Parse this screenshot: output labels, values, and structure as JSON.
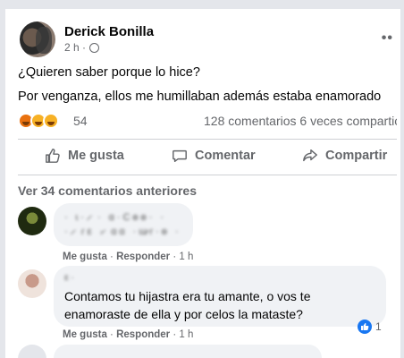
{
  "post": {
    "author": "Derick Bonilla",
    "time": "2 h ·",
    "line1": "¿Quieren saber porque lo hice?",
    "line2": "Por venganza, ellos me humillaban además estaba enamorado",
    "reaction_count": "54",
    "stats": "128 comentarios  6 veces compartic"
  },
  "actions": {
    "like": "Me gusta",
    "comment": "Comentar",
    "share": "Compartir"
  },
  "comments": {
    "view_more": "Ver 34 comentarios anteriores",
    "c1": {
      "line1": "· ɩ· ̷  ·  ɑ·Cɵɵ·  ·",
      "line2": "· ̷ ɾɛ ·̷   ɑɑ ·ɯ̷ɾ·ɵ  ·",
      "meta_like": "Me gusta",
      "meta_reply": "Responder",
      "meta_time": "1 h"
    },
    "c2": {
      "name": "ɛ ·",
      "text": "Contamos tu hijastra era tu amante, o vos te enamoraste de ella y por celos la mataste?",
      "reaction_count": "1",
      "meta_like": "Me gusta",
      "meta_reply": "Responder",
      "meta_time": "1 h"
    }
  },
  "colors": {
    "accent": "#1877f2",
    "secondary_text": "#65676b",
    "bubble": "#f0f2f5"
  }
}
